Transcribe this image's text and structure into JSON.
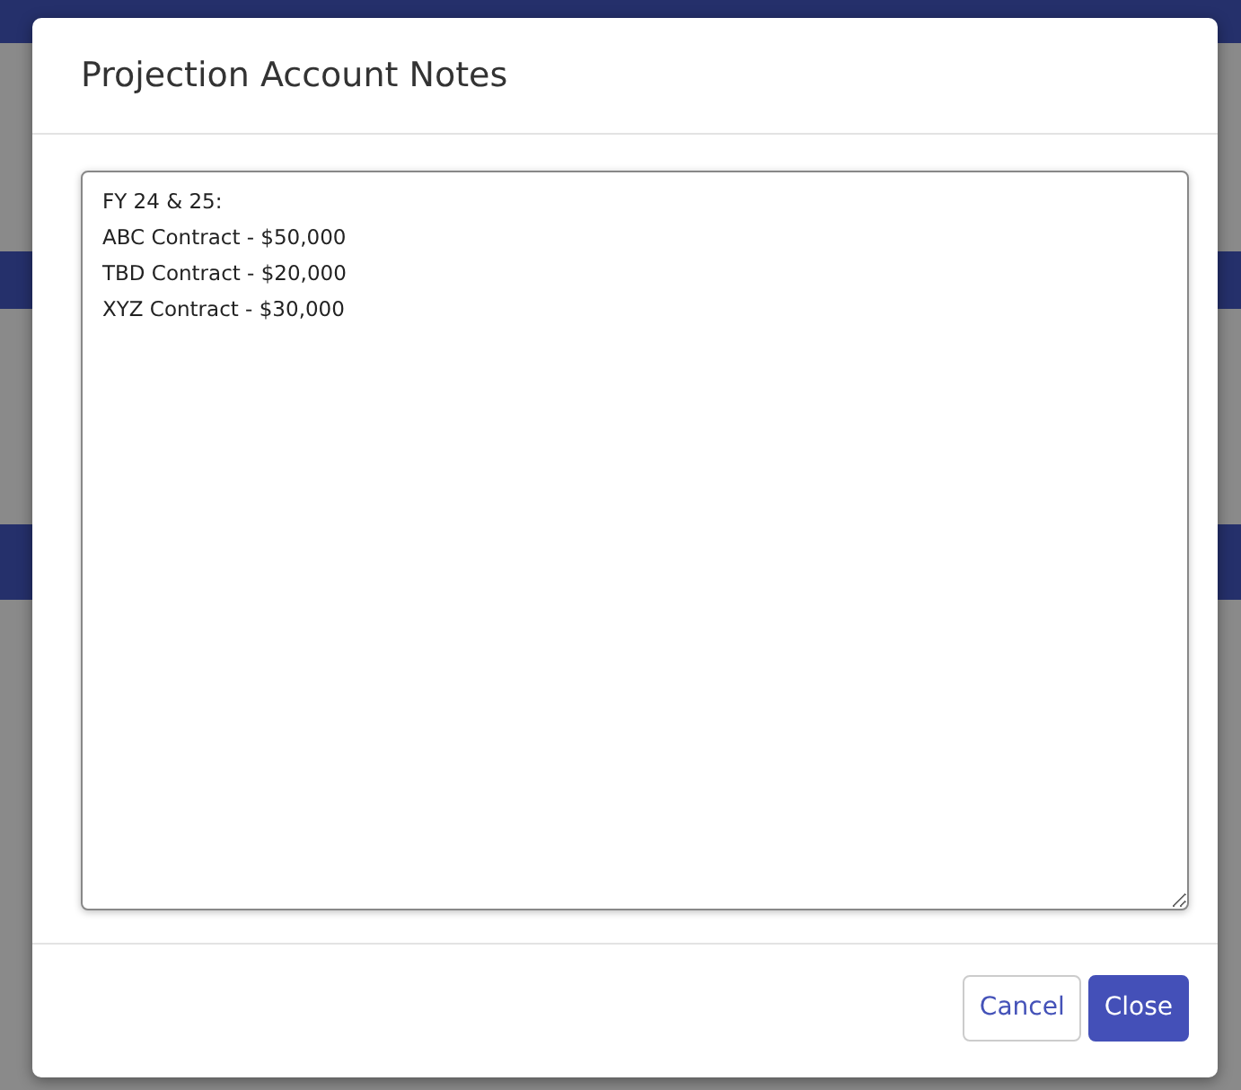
{
  "dialog": {
    "title": "Projection Account Notes",
    "notes": [
      "FY 24 & 25:",
      "ABC Contract - $50,000",
      "TBD Contract - $20,000",
      "XYZ Contract - $30,000"
    ],
    "buttons": [
      {
        "label": "Cancel",
        "kind": "secondary"
      },
      {
        "label": "Close",
        "kind": "primary"
      }
    ]
  }
}
